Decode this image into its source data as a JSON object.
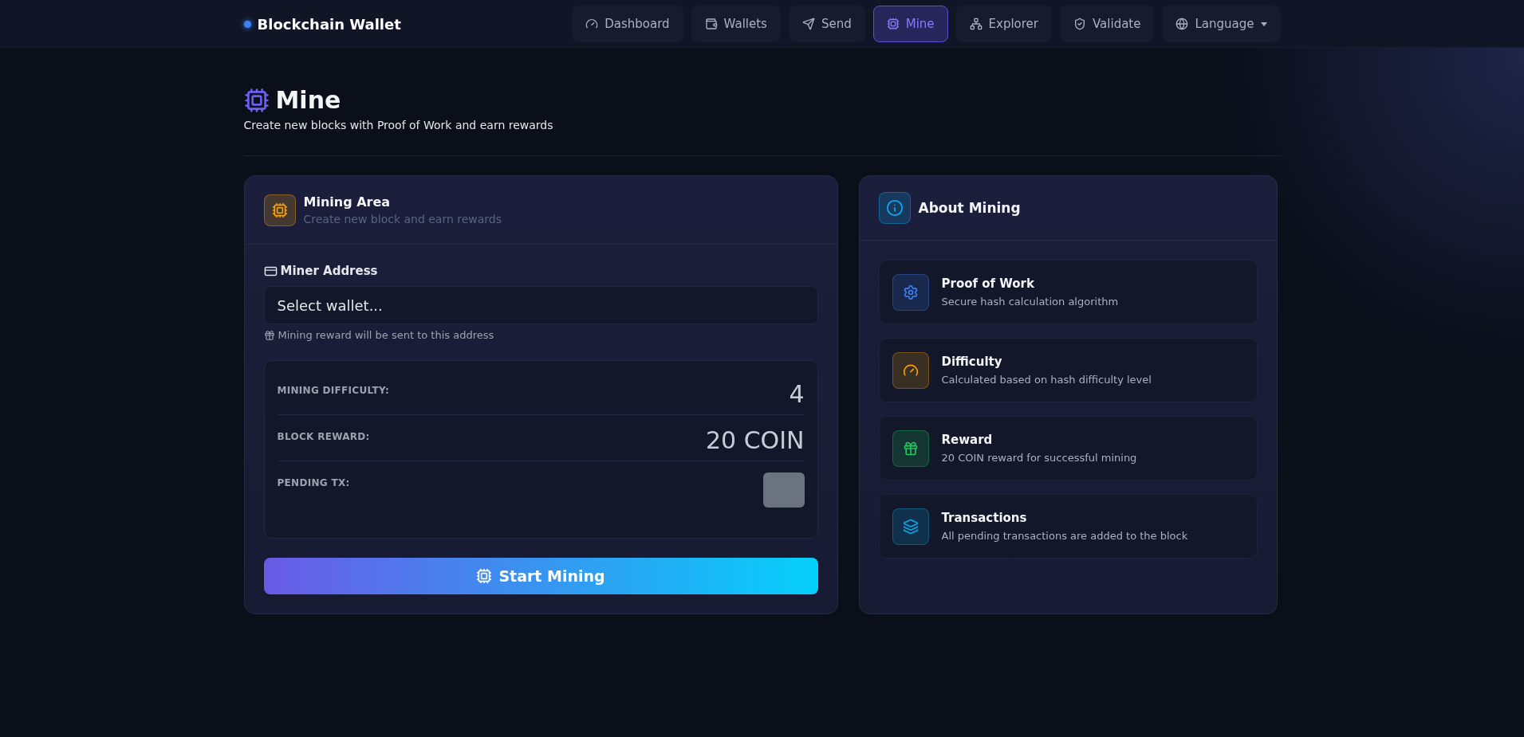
{
  "brand": {
    "name": "Blockchain Wallet"
  },
  "nav": [
    {
      "label": "Dashboard",
      "selected": false,
      "kind": "link"
    },
    {
      "label": "Wallets",
      "selected": false,
      "kind": "link"
    },
    {
      "label": "Send",
      "selected": false,
      "kind": "link"
    },
    {
      "label": "Mine",
      "selected": true,
      "kind": "link"
    },
    {
      "label": "Explorer",
      "selected": false,
      "kind": "link"
    },
    {
      "label": "Validate",
      "selected": false,
      "kind": "link"
    },
    {
      "label": "Language",
      "selected": false,
      "kind": "dropdown"
    }
  ],
  "page": {
    "title": "Mine",
    "subtitle": "Create new blocks with Proof of Work and earn rewards"
  },
  "mining_card": {
    "title": "Mining Area",
    "subtitle": "Create new block and earn rewards",
    "address_label": "Miner Address",
    "address_placeholder": "Select wallet...",
    "hint": "Mining reward will be sent to this address",
    "stats": [
      {
        "label": "MINING DIFFICULTY:",
        "value": "4"
      },
      {
        "label": "BLOCK REWARD:",
        "value": "20 COIN"
      },
      {
        "label": "PENDING TX:",
        "kind": "badge"
      }
    ],
    "button": "Start Mining"
  },
  "about_card": {
    "title": "About Mining",
    "items": [
      {
        "title": "Proof of Work",
        "text": "Secure hash calculation algorithm",
        "color": "#3b82f6"
      },
      {
        "title": "Difficulty",
        "text": "Calculated based on hash difficulty level",
        "color": "#f59e0b"
      },
      {
        "title": "Reward",
        "text": "20 COIN reward for successful mining",
        "color": "#22c55e"
      },
      {
        "title": "Transactions",
        "text": "All pending transactions are added to the block",
        "color": "#0ea5e9"
      }
    ]
  }
}
